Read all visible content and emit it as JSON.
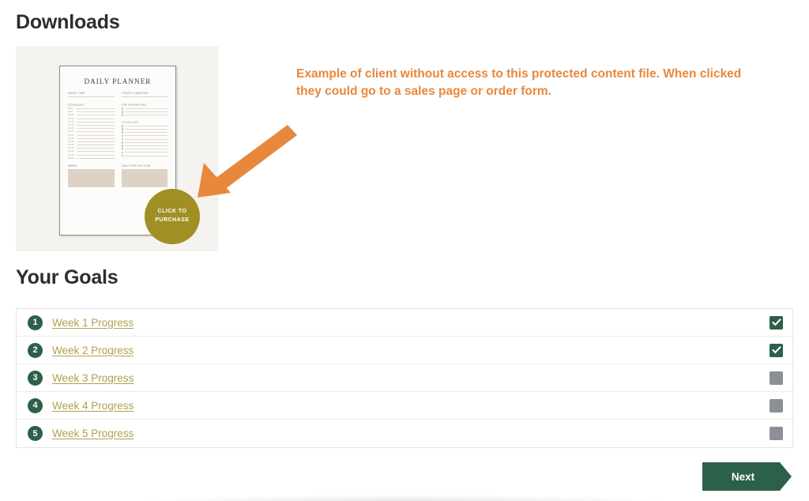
{
  "sections": {
    "downloads_title": "Downloads",
    "goals_title": "Your Goals"
  },
  "download_preview": {
    "annotation": "Example of client without access to this protected content file. When clicked they could go to a sales page or order form.",
    "annotation_color": "#e8883c",
    "arrow_color": "#e8883c",
    "badge": {
      "line1": "CLICK TO",
      "line2": "PURCHASE",
      "color": "#a08f24",
      "text_color": "#ffffff"
    },
    "planner": {
      "title": "DAILY PLANNER",
      "wake_time_label": "WAKE TIME",
      "mantra_label": "TODAY'S MANTRA",
      "schedule_label": "SCHEDULE",
      "priorities_label": "TOP PRIORITIES",
      "todo_label": "TO-DO LIST",
      "memo_label": "MEMO",
      "reflection_label": "DAILY REFLECTION",
      "schedule_times": [
        "8:00",
        "9:00",
        "10:00",
        "11:00",
        "12:00",
        "13:00",
        "14:00",
        "15:00",
        "16:00",
        "17:00",
        "18:00",
        "19:00",
        "20:00",
        "21:00",
        "22:00",
        "23:00"
      ],
      "priority_count": 3,
      "todo_count": 10,
      "page_background": "#f4f3f0",
      "sheet_background": "#fdfcfa",
      "swatch_color": "#ded2c6"
    }
  },
  "goals": {
    "accent_green": "#2c6049",
    "link_color": "#b0a04e",
    "unchecked_color": "#8c8f96",
    "rows": [
      {
        "number": "1",
        "label": "Week 1 Progress",
        "checked": true
      },
      {
        "number": "2",
        "label": "Week 2 Progress",
        "checked": true
      },
      {
        "number": "3",
        "label": "Week 3 Progress",
        "checked": false
      },
      {
        "number": "4",
        "label": "Week 4 Progress",
        "checked": false
      },
      {
        "number": "5",
        "label": "Week 5 Progress",
        "checked": false
      }
    ]
  },
  "footer": {
    "next_label": "Next",
    "next_color": "#2c6049"
  }
}
